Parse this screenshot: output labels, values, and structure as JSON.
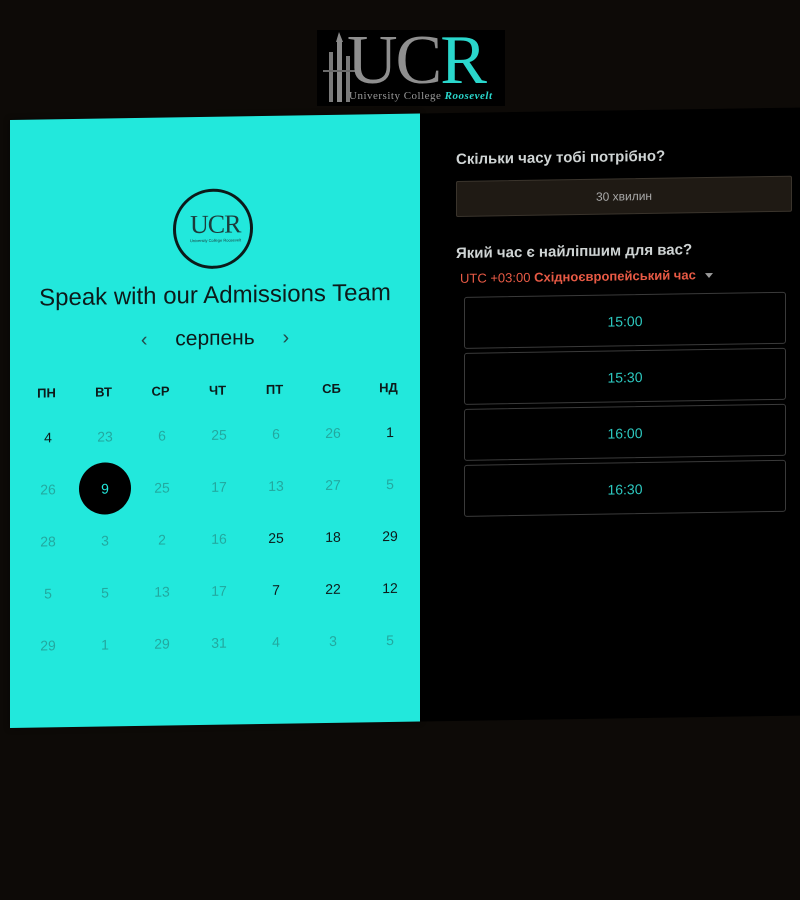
{
  "logo": {
    "letters_main": "UC",
    "letter_accent": "R",
    "subtitle_prefix": "University College ",
    "subtitle_accent": "Roosevelt"
  },
  "calendar": {
    "badge_text": "UCR",
    "badge_sub": "University College Roosevelt",
    "headline": "Speak with our Admissions Team",
    "month": "серпень",
    "prev_icon": "‹",
    "next_icon": "›",
    "weekdays": [
      "ПН",
      "ВТ",
      "СР",
      "ЧТ",
      "ПТ",
      "СБ",
      "НД"
    ],
    "weeks": [
      [
        {
          "d": "4",
          "a": true
        },
        {
          "d": "23",
          "a": false
        },
        {
          "d": "6",
          "a": false
        },
        {
          "d": "25",
          "a": false
        },
        {
          "d": "6",
          "a": false
        },
        {
          "d": "26",
          "a": false
        },
        {
          "d": "1",
          "a": true
        }
      ],
      [
        {
          "d": "26",
          "a": false
        },
        {
          "d": "9",
          "a": true,
          "s": true
        },
        {
          "d": "25",
          "a": false
        },
        {
          "d": "17",
          "a": false
        },
        {
          "d": "13",
          "a": false
        },
        {
          "d": "27",
          "a": false
        },
        {
          "d": "5",
          "a": false
        }
      ],
      [
        {
          "d": "28",
          "a": false
        },
        {
          "d": "3",
          "a": false
        },
        {
          "d": "2",
          "a": false
        },
        {
          "d": "16",
          "a": false
        },
        {
          "d": "25",
          "a": true
        },
        {
          "d": "18",
          "a": true
        },
        {
          "d": "29",
          "a": true
        }
      ],
      [
        {
          "d": "5",
          "a": false
        },
        {
          "d": "5",
          "a": false
        },
        {
          "d": "13",
          "a": false
        },
        {
          "d": "17",
          "a": false
        },
        {
          "d": "7",
          "a": true
        },
        {
          "d": "22",
          "a": true
        },
        {
          "d": "12",
          "a": true
        }
      ],
      [
        {
          "d": "29",
          "a": false
        },
        {
          "d": "1",
          "a": false
        },
        {
          "d": "29",
          "a": false
        },
        {
          "d": "31",
          "a": false
        },
        {
          "d": "4",
          "a": false
        },
        {
          "d": "3",
          "a": false
        },
        {
          "d": "5",
          "a": false
        }
      ]
    ]
  },
  "booking": {
    "duration_question": "Скільки часу тобі потрібно?",
    "duration_value": "30 хвилин",
    "time_question": "Який час є найліпшим для вас?",
    "timezone_offset": "UTC +03:00",
    "timezone_name": "Східноєвропейський час",
    "slots": [
      "15:00",
      "15:30",
      "16:00",
      "16:30"
    ]
  },
  "colors": {
    "accent": "#22e8dc",
    "timezone": "#e85a45",
    "slot_text": "#2dc9c0"
  }
}
